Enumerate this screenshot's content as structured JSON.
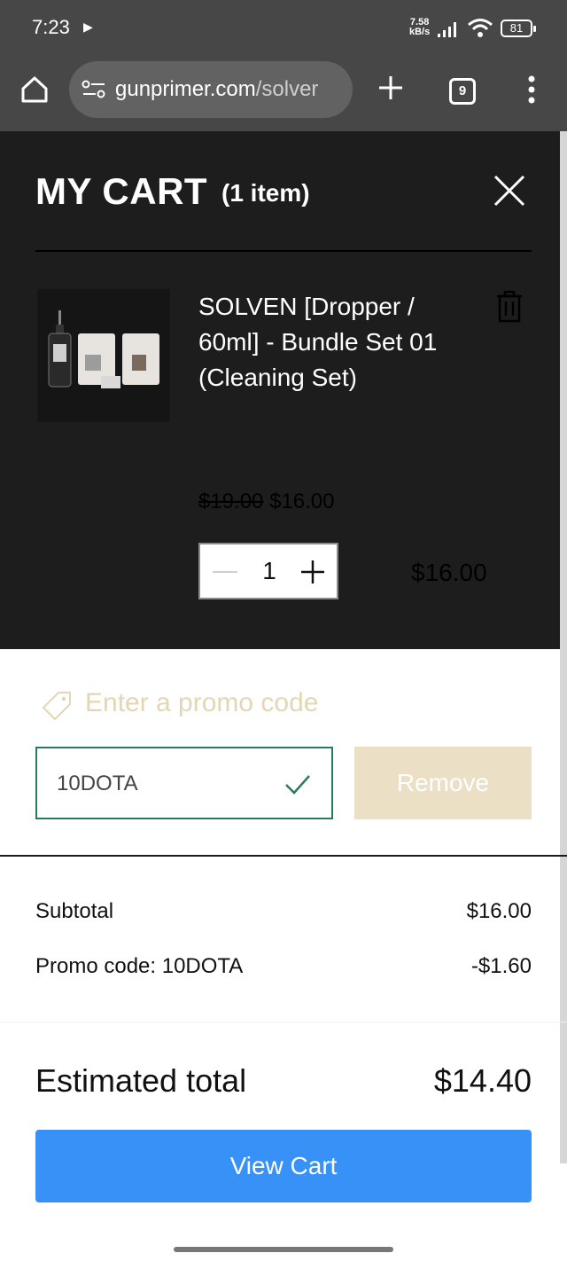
{
  "status_bar": {
    "time": "7:23",
    "net_speed_value": "7.58",
    "net_speed_unit": "kB/s",
    "battery": "81"
  },
  "browser": {
    "url_domain": "gunprimer.com",
    "url_path": "/solver",
    "tab_count": "9"
  },
  "cart": {
    "title": "MY CART",
    "count_label": "(1 item)",
    "item": {
      "name": "SOLVEN [Dropper / 60ml] - Bundle Set 01 (Cleaning Set)",
      "original_price": "$19.00",
      "sale_price": "$16.00",
      "quantity": "1",
      "line_total": "$16.00"
    }
  },
  "promo": {
    "label": "Enter a promo code",
    "code": "10DOTA",
    "remove_label": "Remove"
  },
  "summary": {
    "subtotal_label": "Subtotal",
    "subtotal_value": "$16.00",
    "promo_label": "Promo code: 10DOTA",
    "promo_value": "-$1.60",
    "total_label": "Estimated total",
    "total_value": "$14.40"
  },
  "view_cart_label": "View Cart",
  "colors": {
    "dark_panel": "#1d1d1d",
    "browser_bar": "#474747",
    "promo_accent": "#e4d6b4",
    "input_border": "#2a7a62",
    "remove_button": "#ebe0c5",
    "primary_button": "#3891f7"
  }
}
